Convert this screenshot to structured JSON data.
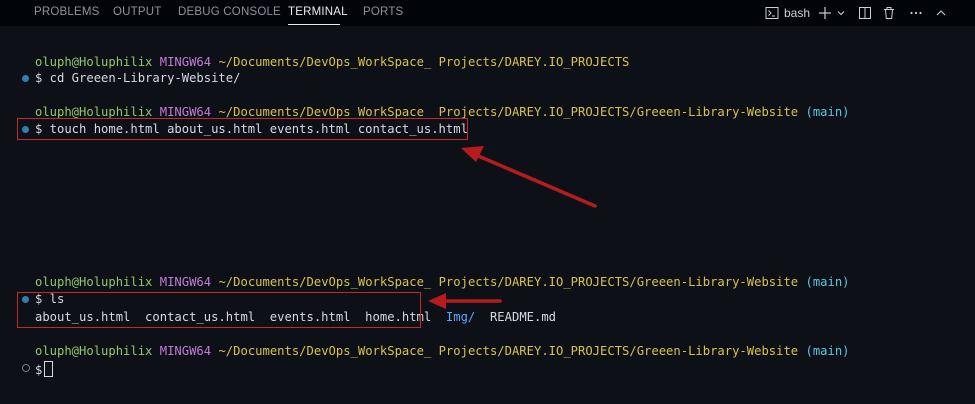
{
  "panel_tabs": [
    "PROBLEMS",
    "OUTPUT",
    "DEBUG CONSOLE",
    "TERMINAL",
    "PORTS"
  ],
  "active_tab": "TERMINAL",
  "toolbar": {
    "shell_label": "bash",
    "shell_icon": "terminal-icon",
    "new_icon": "plus-icon",
    "dropdown_icon": "chevron-down-icon",
    "split_icon": "split-icon",
    "trash_icon": "trash-icon",
    "more_icon": "ellipsis-icon",
    "maximize_icon": "chevron-up-icon"
  },
  "prompt": {
    "user_host": "oluph@Holuphilix",
    "system": "MINGW64",
    "path_1": "~/Documents/DevOps_WorkSpace_ Projects/DAREY.IO_PROJECTS",
    "path_2": "~/Documents/DevOps_WorkSpace_ Projects/DAREY.IO_PROJECTS/Greeen-Library-Website",
    "branch": "(main)"
  },
  "commands": {
    "cd": "$ cd Greeen-Library-Website/",
    "touch": "$ touch home.html about_us.html events.html contact_us.html",
    "ls": "$ ls",
    "final": "$"
  },
  "ls_output": {
    "files": "about_us.html  contact_us.html  events.html  home.html",
    "dir": "Img/",
    "readme": "README.md"
  },
  "colors": {
    "user": "#8fc86c",
    "host": "#c47ad8",
    "path": "#d8c24c",
    "branch": "#5ac7e0",
    "directory": "#58a6ff",
    "annotation": "#c62828",
    "background": "#0d1117"
  }
}
